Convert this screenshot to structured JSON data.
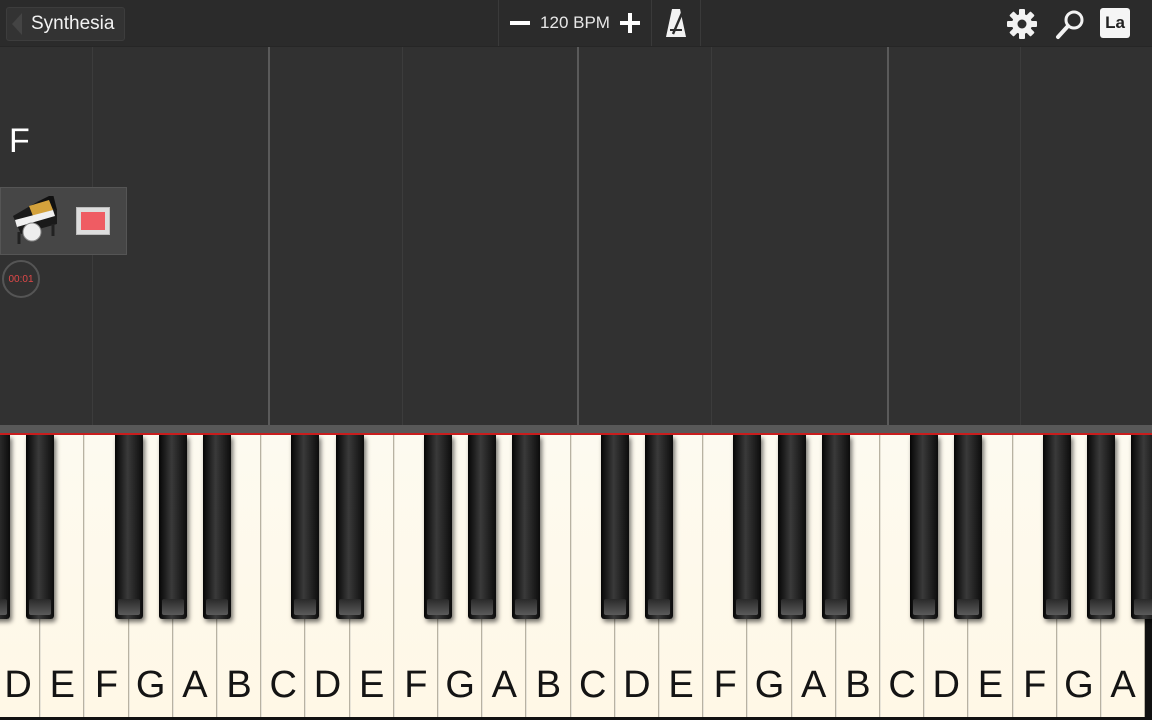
{
  "app": {
    "back_label": "Synthesia",
    "bpm_label": "120 BPM",
    "lang_label": "La"
  },
  "roll": {
    "current_note": "F"
  },
  "recorder": {
    "timer": "00:01",
    "record_color": "#ef5c63"
  },
  "icons": {
    "back": "chevron-left-icon",
    "minus": "minus-icon",
    "plus": "plus-icon",
    "metronome": "metronome-icon",
    "settings": "gear-icon",
    "search": "search-icon",
    "language": "language-icon",
    "instrument": "grand-piano-icon"
  },
  "keyboard": {
    "white_keys": [
      "D",
      "E",
      "F",
      "G",
      "A",
      "B",
      "C",
      "D",
      "E",
      "F",
      "G",
      "A",
      "B",
      "C",
      "D",
      "E",
      "F",
      "G",
      "A",
      "B",
      "C",
      "D",
      "E",
      "F",
      "G",
      "A"
    ],
    "accent_line_color": "#c81d1d"
  }
}
